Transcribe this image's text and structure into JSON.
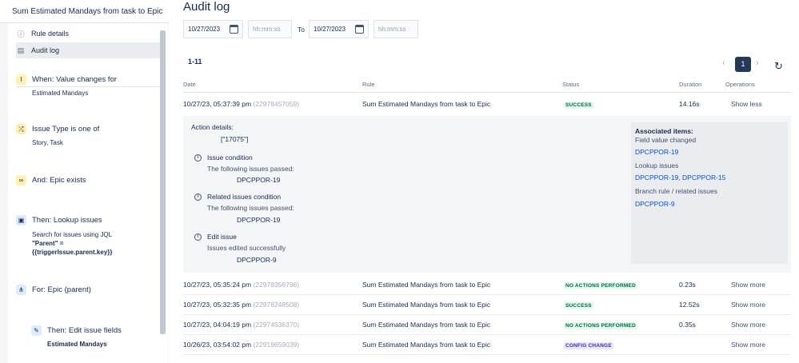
{
  "sidebar": {
    "rule_title": "Sum Estimated Mandays from task to Epic",
    "nav": [
      {
        "label": "Rule details",
        "icon": "info-icon"
      },
      {
        "label": "Audit log",
        "icon": "document-icon"
      }
    ],
    "steps": [
      {
        "title": "When: Value changes for",
        "sub": "Estimated Mandays",
        "icon": "field-trigger-icon"
      },
      {
        "title": "Issue Type is one of",
        "sub": "Story, Task",
        "icon": "shuffle-icon"
      },
      {
        "title": "And: Epic exists",
        "icon": "link-icon"
      },
      {
        "title": "Then: Lookup issues",
        "sub1": "Search for issues using JQL",
        "sub2": "\"Parent\" =",
        "sub3": "{{triggerIssue.parent.key}}",
        "icon": "lookup-icon"
      },
      {
        "title": "For: Epic (parent)",
        "icon": "hierarchy-icon"
      },
      {
        "title": "Then: Edit issue fields",
        "sub": "Estimated Mandays",
        "icon": "pencil-icon"
      }
    ]
  },
  "main": {
    "title": "Audit log",
    "filter": {
      "from_date": "10/27/2023",
      "from_time_placeholder": "hh:mm:ss",
      "to_label": "To",
      "to_date": "10/27/2023",
      "to_time_placeholder": "hh:mm:ss"
    },
    "range": "1-11",
    "pager": {
      "prev": "‹",
      "page": "1",
      "next": "›"
    },
    "columns": {
      "date": "Date",
      "rule": "Rule",
      "status": "Status",
      "duration": "Duration",
      "operations": "Operations"
    },
    "rows": [
      {
        "date": "10/27/23, 05:37:39 pm",
        "id": "(22978457059)",
        "rule": "Sum Estimated Mandays from task to Epic",
        "status": "SUCCESS",
        "status_color": "#006644",
        "duration": "14.16s",
        "op": "Show less"
      },
      {
        "date": "10/27/23, 05:35:24 pm",
        "id": "(22978356796)",
        "rule": "Sum Estimated Mandays from task to Epic",
        "status": "NO ACTIONS PERFORMED",
        "status_color": "#006644",
        "duration": "0.23s",
        "op": "Show more"
      },
      {
        "date": "10/27/23, 05:32:35 pm",
        "id": "(22978248508)",
        "rule": "Sum Estimated Mandays from task to Epic",
        "status": "SUCCESS",
        "status_color": "#006644",
        "duration": "12.52s",
        "op": "Show more"
      },
      {
        "date": "10/27/23, 04:04:19 pm",
        "id": "(22974536370)",
        "rule": "Sum Estimated Mandays from task to Epic",
        "status": "NO ACTIONS PERFORMED",
        "status_color": "#006644",
        "duration": "0.35s",
        "op": "Show more"
      },
      {
        "date": "10/26/23, 03:54:02 pm",
        "id": "(22919659039)",
        "rule": "Sum Estimated Mandays from task to Epic",
        "status": "CONFIG CHANGE",
        "status_color": "#403294",
        "duration": "",
        "op": "Show more"
      }
    ],
    "details": {
      "action_label": "Action details:",
      "action_value": "[\"17075\"]",
      "conditions": [
        {
          "title": "Issue condition",
          "desc": "The following issues passed:",
          "issue": "DPCPPOR-19"
        },
        {
          "title": "Related issues condition",
          "desc": "The following issues passed:",
          "issue": "DPCPPOR-19"
        },
        {
          "title": "Edit issue",
          "desc": "Issues edited successfully",
          "issue": "DPCPPOR-9"
        }
      ],
      "associated": {
        "heading": "Associated items:",
        "groups": [
          {
            "label": "Field value changed",
            "links": "DPCPPOR-19"
          },
          {
            "label": "Lookup issues",
            "links": "DPCPPOR-19, DPCPPOR-15"
          },
          {
            "label": "Branch rule / related issues",
            "links": "DPCPPOR-9"
          }
        ]
      }
    }
  }
}
